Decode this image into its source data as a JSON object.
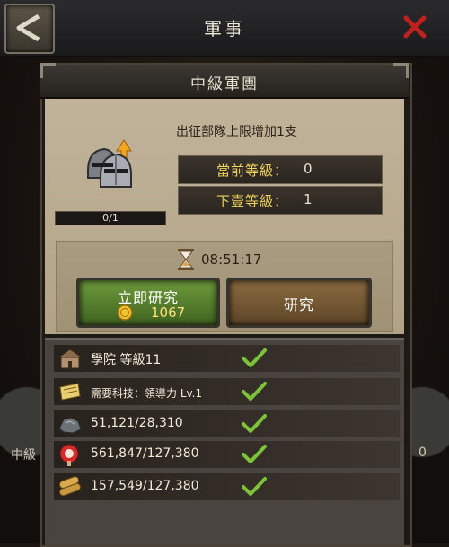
{
  "header": {
    "title": "軍事"
  },
  "panel": {
    "title": "中級軍團"
  },
  "upgrade": {
    "bonus_text": "出征部隊上限增加1支",
    "progress_text": "0/1",
    "progress_fraction": 0,
    "current_level_label": "當前等級：",
    "current_level_value": "0",
    "next_level_label": "下壹等級：",
    "next_level_value": "1"
  },
  "research": {
    "timer": "08:51:17",
    "instant_label": "立即研究",
    "instant_cost": "1067",
    "research_label": "研究"
  },
  "requirements": [
    {
      "icon": "academy-icon",
      "text": "學院 等級11",
      "met": true
    },
    {
      "icon": "tech-scroll-icon",
      "text": "需要科技：領導力 Lv.1",
      "met": true
    },
    {
      "icon": "iron-ore-icon",
      "text": "51,121/28,310",
      "met": true
    },
    {
      "icon": "food-icon",
      "text": "561,847/127,380",
      "met": true
    },
    {
      "icon": "wood-icon",
      "text": "157,549/127,380",
      "met": true
    }
  ],
  "background": {
    "left_label": "中級",
    "right_label": "0"
  },
  "colors": {
    "accent_gold": "#f0d25c",
    "check_green": "#7ec23a",
    "close_red": "#c0211e"
  }
}
